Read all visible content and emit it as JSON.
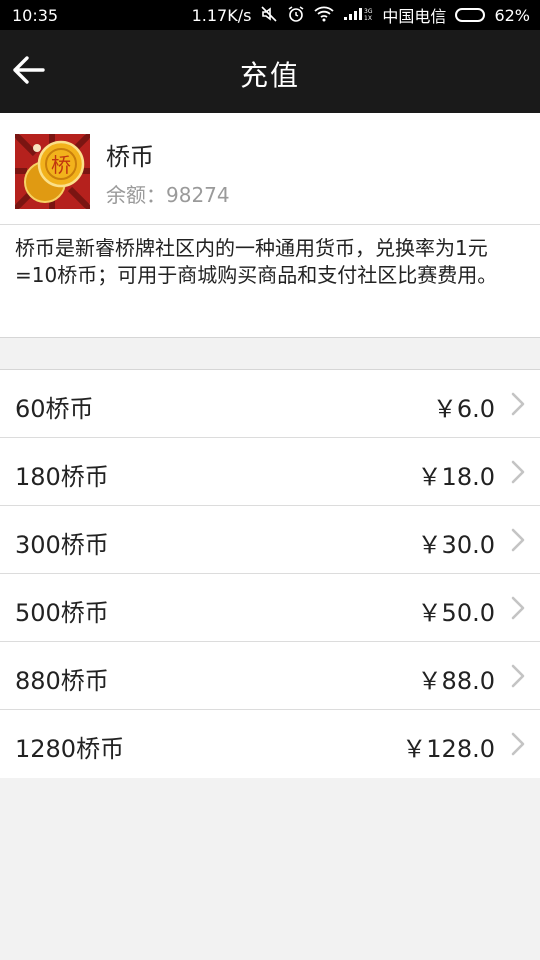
{
  "status_bar": {
    "time": "10:35",
    "speed": "1.17K/s",
    "carrier": "中国电信",
    "battery_text": "62%",
    "battery_level": 0.62,
    "icons": [
      "mute-icon",
      "alarm-icon",
      "wifi-icon",
      "signal-3g-icon",
      "battery-icon"
    ]
  },
  "nav": {
    "title": "充值",
    "back_icon": "back-arrow-icon"
  },
  "card": {
    "icon": "qiaobi-coin-icon",
    "coin_glyph": "桥",
    "name": "桥币",
    "balance_label": "余额：",
    "balance_value": "98274",
    "description": "桥币是新睿桥牌社区内的一种通用货币，兑换率为1元=10桥币；可用于商城购买商品和支付社区比赛费用。"
  },
  "packages": [
    {
      "label": "60桥币",
      "price": "￥6.0"
    },
    {
      "label": "180桥币",
      "price": "￥18.0"
    },
    {
      "label": "300桥币",
      "price": "￥30.0"
    },
    {
      "label": "500桥币",
      "price": "￥50.0"
    },
    {
      "label": "880桥币",
      "price": "￥88.0"
    },
    {
      "label": "1280桥币",
      "price": "￥128.0"
    }
  ],
  "colors": {
    "nav_bg": "#1a1a1a",
    "page_bg": "#f2f2f2",
    "coin_gold": "#f2b21c",
    "coin_bg_red": "#b5211d"
  }
}
